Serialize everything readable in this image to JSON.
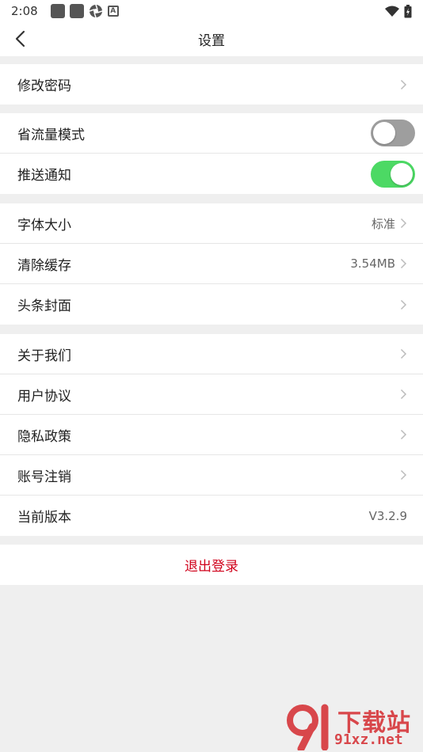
{
  "status_bar": {
    "time": "2:08",
    "small_icon_letter": "A",
    "icons": [
      "notification-square-icon",
      "notification-square-icon",
      "aperture-icon",
      "letter-a-icon",
      "wifi-icon",
      "battery-charging-icon"
    ]
  },
  "header": {
    "title": "设置",
    "back_icon": "chevron-left-icon"
  },
  "account_group": {
    "change_password": "修改密码"
  },
  "toggles_group": {
    "data_saver": {
      "label": "省流量模式",
      "on": false
    },
    "push": {
      "label": "推送通知",
      "on": true
    }
  },
  "display_group": {
    "font_size": {
      "label": "字体大小",
      "value": "标准"
    },
    "clear_cache": {
      "label": "清除缓存",
      "value": "3.54MB"
    },
    "headline_cover": {
      "label": "头条封面"
    }
  },
  "about_group": {
    "about_us": "关于我们",
    "user_agreement": "用户协议",
    "privacy_policy": "隐私政策",
    "account_cancel": "账号注销",
    "version": {
      "label": "当前版本",
      "value": "V3.2.9"
    }
  },
  "logout": {
    "label": "退出登录"
  },
  "watermark": {
    "main": "下载站",
    "sub": "91xz.net"
  },
  "colors": {
    "logout_red": "#d0021b",
    "toggle_on": "#4cd964",
    "toggle_off": "#9e9e9e",
    "background": "#efefef"
  }
}
